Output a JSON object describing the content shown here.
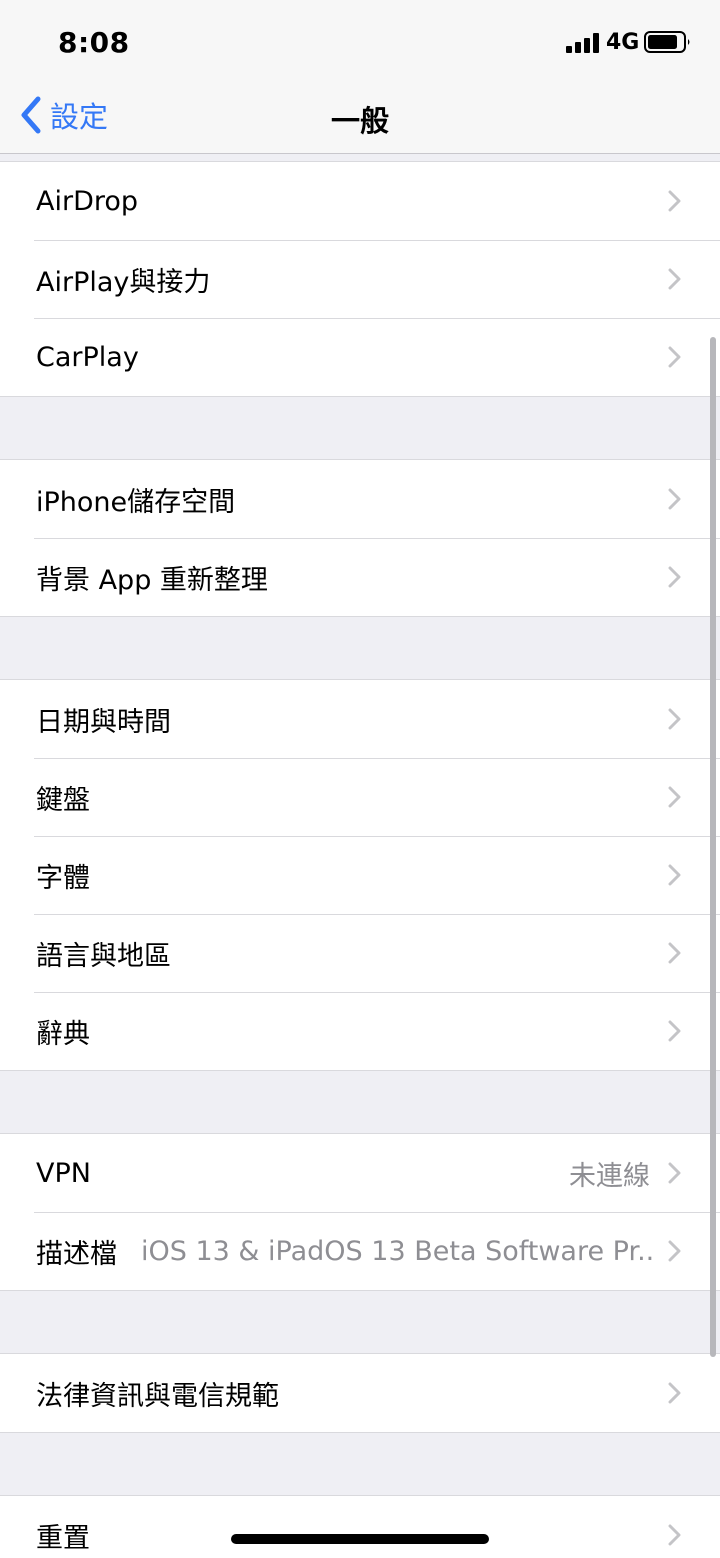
{
  "status_bar": {
    "time": "8:08",
    "network": "4G",
    "signal_icon": "cellular-signal-icon",
    "battery_icon": "battery-icon"
  },
  "nav": {
    "back_label": "設定",
    "title": "一般"
  },
  "rows": {
    "airdrop": "AirDrop",
    "airplay": "AirPlay與接力",
    "carplay": "CarPlay",
    "storage": "iPhone儲存空間",
    "background_refresh": "背景 App 重新整理",
    "date_time": "日期與時間",
    "keyboard": "鍵盤",
    "fonts": "字體",
    "language_region": "語言與地區",
    "dictionary": "辭典",
    "vpn": "VPN",
    "vpn_value": "未連線",
    "profile": "描述檔",
    "profile_value": "iOS 13 & iPadOS 13 Beta Software Pr...",
    "legal": "法律資訊與電信規範",
    "reset": "重置"
  },
  "colors": {
    "accent": "#3478f6",
    "background": "#efeff4",
    "secondary_text": "#8e8e93",
    "chevron": "#c4c4c7"
  }
}
